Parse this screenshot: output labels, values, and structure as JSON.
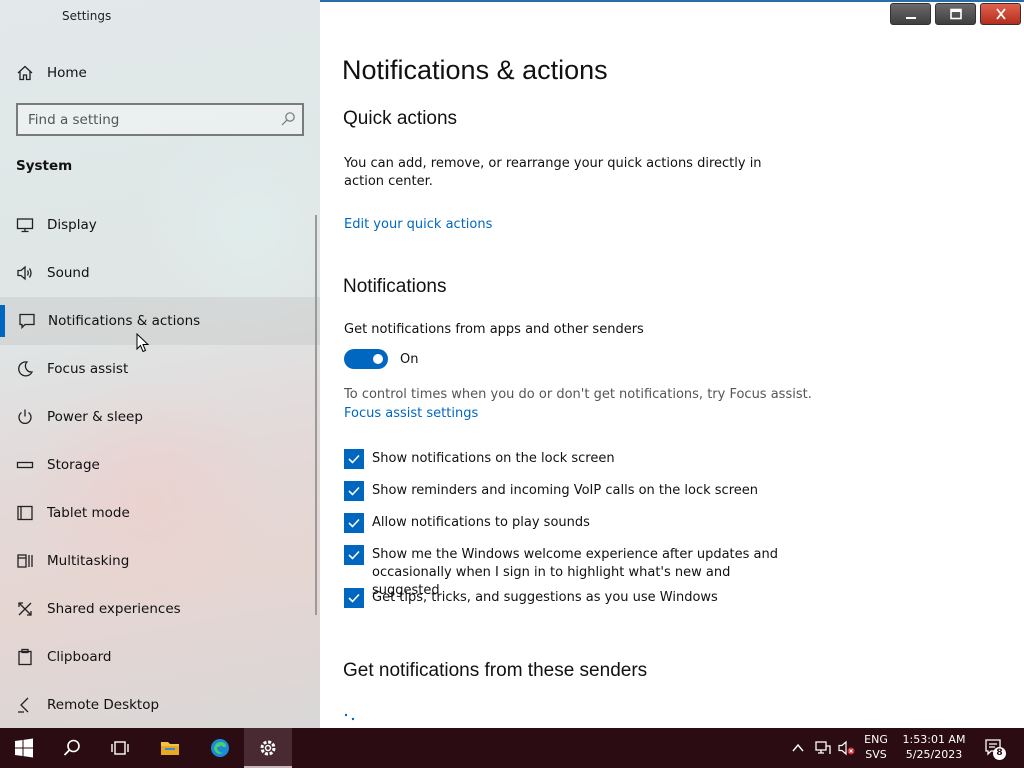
{
  "window": {
    "title": "Settings",
    "controls": {
      "minimize": "minimize",
      "maximize": "maximize",
      "close": "close"
    }
  },
  "sidebar": {
    "home_label": "Home",
    "search_placeholder": "Find a setting",
    "section_label": "System",
    "items": [
      {
        "label": "Display",
        "icon": "monitor-icon"
      },
      {
        "label": "Sound",
        "icon": "speaker-icon"
      },
      {
        "label": "Notifications & actions",
        "icon": "message-icon",
        "active": true
      },
      {
        "label": "Focus assist",
        "icon": "moon-icon"
      },
      {
        "label": "Power & sleep",
        "icon": "power-icon"
      },
      {
        "label": "Storage",
        "icon": "storage-icon"
      },
      {
        "label": "Tablet mode",
        "icon": "tablet-icon"
      },
      {
        "label": "Multitasking",
        "icon": "multitasking-icon"
      },
      {
        "label": "Shared experiences",
        "icon": "shared-icon"
      },
      {
        "label": "Clipboard",
        "icon": "clipboard-icon"
      },
      {
        "label": "Remote Desktop",
        "icon": "remote-desktop-icon"
      }
    ]
  },
  "main": {
    "title": "Notifications & actions",
    "quick_actions": {
      "heading": "Quick actions",
      "description": "You can add, remove, or rearrange your quick actions directly in action center.",
      "link": "Edit your quick actions"
    },
    "notifications": {
      "heading": "Notifications",
      "toggle_caption": "Get notifications from apps and other senders",
      "toggle_state": "On",
      "focus_hint": "To control times when you do or don't get notifications, try Focus assist.",
      "focus_link": "Focus assist settings",
      "checkboxes": [
        {
          "label": "Show notifications on the lock screen",
          "checked": true
        },
        {
          "label": "Show reminders and incoming VoIP calls on the lock screen",
          "checked": true
        },
        {
          "label": "Allow notifications to play sounds",
          "checked": true
        },
        {
          "label": "Show me the Windows welcome experience after updates and occasionally when I sign in to highlight what's new and suggested",
          "checked": true
        },
        {
          "label": "Get tips, tricks, and suggestions as you use Windows",
          "checked": true
        }
      ]
    },
    "senders": {
      "heading": "Get notifications from these senders"
    }
  },
  "taskbar": {
    "apps": [
      "start-icon",
      "search-icon",
      "task-view-icon",
      "file-explorer-icon",
      "edge-icon",
      "settings-icon"
    ],
    "lang_top": "ENG",
    "lang_bottom": "SVS",
    "time": "1:53:01 AM",
    "date": "5/25/2023",
    "notification_count": "8"
  },
  "colors": {
    "accent": "#0067c0",
    "taskbar": "#2a0c12",
    "close_button": "#c8412e"
  }
}
